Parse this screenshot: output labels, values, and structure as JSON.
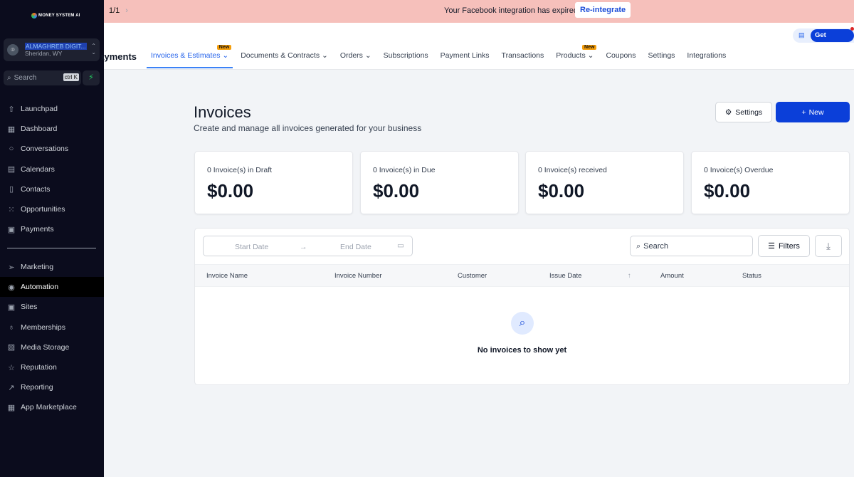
{
  "sidebar": {
    "logo": "MONEY SYSTEM AI",
    "account_name": "ALMAGHREB DIGIT...",
    "account_location": "Sheridan, WY",
    "search_placeholder": "Search",
    "shortcut": "ctrl K",
    "items": [
      {
        "label": "Launchpad",
        "icon": "rocket-icon"
      },
      {
        "label": "Dashboard",
        "icon": "grid-icon"
      },
      {
        "label": "Conversations",
        "icon": "chat-icon"
      },
      {
        "label": "Calendars",
        "icon": "calendar-icon"
      },
      {
        "label": "Contacts",
        "icon": "contacts-icon"
      },
      {
        "label": "Opportunities",
        "icon": "network-icon"
      },
      {
        "label": "Payments",
        "icon": "payments-icon"
      }
    ],
    "items2": [
      {
        "label": "Marketing",
        "icon": "send-icon"
      },
      {
        "label": "Automation",
        "icon": "automation-icon"
      },
      {
        "label": "Sites",
        "icon": "sites-icon"
      },
      {
        "label": "Memberships",
        "icon": "award-icon"
      },
      {
        "label": "Media Storage",
        "icon": "image-icon"
      },
      {
        "label": "Reputation",
        "icon": "star-icon"
      },
      {
        "label": "Reporting",
        "icon": "trend-icon"
      },
      {
        "label": "App Marketplace",
        "icon": "apps-icon"
      }
    ]
  },
  "banner": {
    "pager": "1/1",
    "message": "Your Facebook integration has expired.",
    "action": "Re-integrate"
  },
  "topnav": {
    "title": "Payments",
    "get_started": "Get Started",
    "new_badge": "New",
    "tabs": [
      "Invoices & Estimates",
      "Documents & Contracts",
      "Orders",
      "Subscriptions",
      "Payment Links",
      "Transactions",
      "Products",
      "Coupons",
      "Settings",
      "Integrations"
    ]
  },
  "page": {
    "title": "Invoices",
    "subtitle": "Create and manage all invoices generated for your business",
    "settings": "Settings",
    "new": "New"
  },
  "cards": [
    {
      "label": "0 Invoice(s) in Draft",
      "value": "$0.00"
    },
    {
      "label": "0 Invoice(s) in Due",
      "value": "$0.00"
    },
    {
      "label": "0 Invoice(s) received",
      "value": "$0.00"
    },
    {
      "label": "0 Invoice(s) Overdue",
      "value": "$0.00"
    }
  ],
  "table": {
    "start_date": "Start Date",
    "end_date": "End Date",
    "search": "Search",
    "filters": "Filters",
    "columns": [
      "Invoice Name",
      "Invoice Number",
      "Customer",
      "Issue Date",
      "Amount",
      "Status"
    ],
    "empty": "No invoices to show yet"
  }
}
